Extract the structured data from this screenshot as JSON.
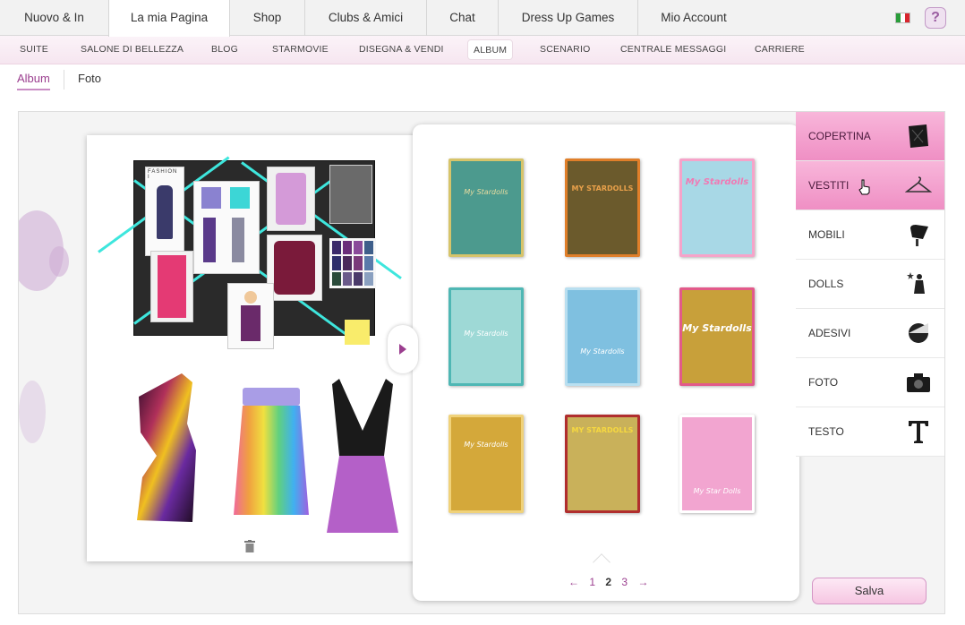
{
  "topnav": {
    "tabs": [
      {
        "label": "Nuovo & In"
      },
      {
        "label": "La mia Pagina",
        "active": true
      },
      {
        "label": "Shop"
      },
      {
        "label": "Clubs & Amici"
      },
      {
        "label": "Chat"
      },
      {
        "label": "Dress Up Games"
      },
      {
        "label": "Mio Account"
      }
    ],
    "help": "?",
    "flag_colors": [
      "#2a9d3a",
      "#ffffff",
      "#d8262e"
    ]
  },
  "subnav": {
    "items": [
      {
        "label": "SUITE"
      },
      {
        "label": "SALONE DI BELLEZZA"
      },
      {
        "label": "BLOG"
      },
      {
        "label": "STARMOVIE"
      },
      {
        "label": "DISEGNA & VENDI"
      },
      {
        "label": "ALBUM",
        "active": true
      },
      {
        "label": "SCENARIO"
      },
      {
        "label": "CENTRALE MESSAGGI"
      },
      {
        "label": "CARRIERE"
      }
    ]
  },
  "album_tabs": [
    {
      "label": "Album",
      "active": true
    },
    {
      "label": "Foto"
    }
  ],
  "moodboard": {
    "fashion_label": "FASHION I",
    "swatch_colors": [
      "#3b2a6a",
      "#6a2e7a",
      "#8a4a9a",
      "#3e5e8a",
      "#2e2e6a",
      "#4a2a5a",
      "#7a3a7a",
      "#5a7aaa",
      "#2a4a3a",
      "#6a5a8a",
      "#4a3a6a",
      "#8aa0c0"
    ]
  },
  "covers": [
    {
      "label": "My Stardolls",
      "bg": "#4c9a8e",
      "accent": "#d7c46a",
      "text": "#e8dca0"
    },
    {
      "label": "MY STARDOLLS",
      "bg": "#6b5a2c",
      "accent": "#e07f2a",
      "text": "#e8a04a"
    },
    {
      "label": "My Stardolls",
      "bg": "#a8d8e6",
      "accent": "#f6a3c9",
      "text": "#f07ab4"
    },
    {
      "label": "My Stardolls",
      "bg": "#9ed9d6",
      "accent": "#4fb7b4",
      "text": "#ffffff"
    },
    {
      "label": "My Stardolls",
      "bg": "#7fc0e0",
      "accent": "#b9dff0",
      "text": "#ffffff"
    },
    {
      "label": "My Stardolls",
      "bg": "#c8a03a",
      "accent": "#e25a8a",
      "text": "#ffffff"
    },
    {
      "label": "My Stardolls",
      "bg": "#d4a83a",
      "accent": "#f0d27a",
      "text": "#ffffff"
    },
    {
      "label": "MY STARDOLLS",
      "bg": "#c9b15a",
      "accent": "#b02e2e",
      "text": "#f6d840"
    },
    {
      "label": "My Star Dolls",
      "bg": "#f2a5d0",
      "accent": "#ffffff",
      "text": "#ffffff"
    }
  ],
  "pager": {
    "prev": "←",
    "pages": [
      "1",
      "2",
      "3"
    ],
    "current": "2",
    "next": "→"
  },
  "categories": [
    {
      "label": "COPERTINA",
      "icon": "book-cover-icon",
      "active": true
    },
    {
      "label": "VESTITI",
      "icon": "hanger-icon",
      "active": true
    },
    {
      "label": "MOBILI",
      "icon": "chair-icon"
    },
    {
      "label": "DOLLS",
      "icon": "doll-icon"
    },
    {
      "label": "ADESIVI",
      "icon": "sticker-icon"
    },
    {
      "label": "FOTO",
      "icon": "camera-icon"
    },
    {
      "label": "TESTO",
      "icon": "text-icon"
    }
  ],
  "save_label": "Salva",
  "accent_color": "#9b3e8f"
}
